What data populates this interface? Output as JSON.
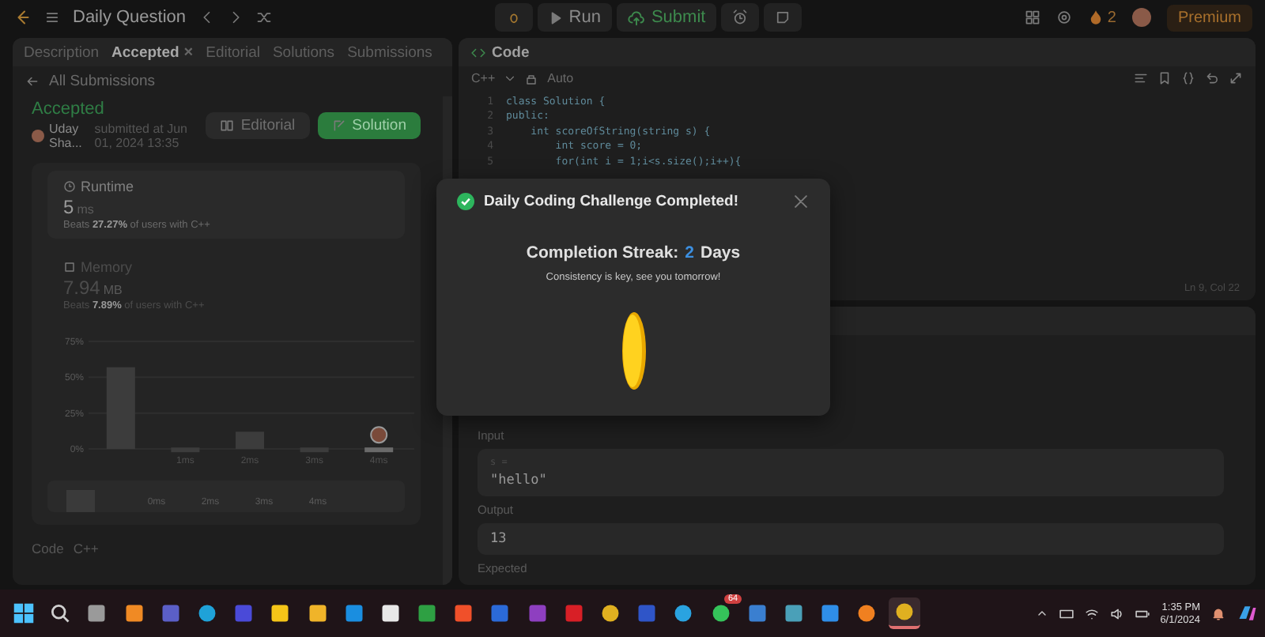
{
  "top_bar": {
    "title": "Daily Question",
    "run": "Run",
    "submit": "Submit",
    "streak": "2",
    "premium": "Premium"
  },
  "left_panel": {
    "tabs": [
      {
        "label": "Description",
        "selected": false
      },
      {
        "label": "Accepted",
        "selected": true,
        "close": "×"
      },
      {
        "label": "Editorial",
        "selected": false
      },
      {
        "label": "Solutions",
        "selected": false
      },
      {
        "label": "Submissions",
        "selected": false
      }
    ],
    "back_link": "All Submissions",
    "status": "Accepted",
    "author": "Uday Sha...",
    "submitted": "submitted at Jun 01, 2024 13:35",
    "buttons": [
      {
        "label": "Editorial",
        "kind": "secondary"
      },
      {
        "label": "Solution",
        "kind": "primary"
      }
    ],
    "stats": [
      {
        "title": "Runtime",
        "value": "5",
        "unit": "ms",
        "beats": "Beats **27.27%** of users with C++",
        "selected": true
      },
      {
        "title": "Memory",
        "value": "7.94",
        "unit": "MB",
        "beats": "Beats **7.89%** of users with C++",
        "selected": false
      }
    ],
    "runtime_chart": {
      "chart_data": {
        "type": "bar",
        "x": [
          0,
          1,
          2,
          3,
          4
        ],
        "values": [
          57,
          1,
          12,
          1,
          1
        ],
        "xlim": [
          -0.5,
          4.5
        ],
        "ylim": [
          0,
          75
        ],
        "yticks": [
          {
            "value": 0,
            "label": "0%"
          },
          {
            "value": 25,
            "label": "25%"
          },
          {
            "value": 50,
            "label": "50%"
          },
          {
            "value": 75,
            "label": "75%"
          }
        ],
        "xticks": [
          {
            "value": 1,
            "label": "1ms"
          },
          {
            "value": 2,
            "label": "2ms"
          },
          {
            "value": 3,
            "label": "3ms"
          },
          {
            "value": 4,
            "label": "4ms"
          }
        ]
      }
    },
    "range_labels": [
      "0ms",
      "2ms",
      "3ms",
      "4ms"
    ],
    "footer": {
      "label": "Code",
      "language": "C++"
    }
  },
  "code_panel": {
    "title": "Code",
    "language": "C++",
    "mode": "Auto",
    "lines": [
      {
        "number": "1",
        "text": "class Solution {"
      },
      {
        "number": "2",
        "text": "public:"
      },
      {
        "number": "3",
        "text": "    int scoreOfString(string s) {"
      },
      {
        "number": "4",
        "text": "        int score = 0;"
      },
      {
        "number": "5",
        "text": "        for(int i = 1;i<s.size();i++){"
      }
    ],
    "position": "Ln 9, Col 22"
  },
  "test_panel": {
    "sections": [
      {
        "label": "Input",
        "variable": "s =",
        "value": "\"hello\""
      },
      {
        "label": "Output",
        "value": "13"
      },
      {
        "label": "Expected"
      }
    ]
  },
  "dialog": {
    "title": "Daily Coding Challenge Completed!",
    "streak_label": "Completion Streak:",
    "streak_value": "2",
    "streak_unit": "Days",
    "message": "Consistency is key, see you tomorrow!"
  },
  "taskbar": {
    "apps": [
      {
        "kind": "start",
        "color": "#4cc2ff",
        "selected": false
      },
      {
        "kind": "search",
        "color": "#d0d0d0",
        "selected": false
      },
      {
        "kind": "tile",
        "color": "#9a9a9a",
        "selected": false
      },
      {
        "kind": "tile",
        "color": "#f08a24",
        "selected": false
      },
      {
        "kind": "tile",
        "color": "#5b5fc7",
        "selected": false
      },
      {
        "kind": "circle",
        "color": "#1fa2d8",
        "selected": false
      },
      {
        "kind": "tile",
        "color": "#4a4ad8",
        "selected": false
      },
      {
        "kind": "tile",
        "color": "#f5c518",
        "selected": false
      },
      {
        "kind": "tile",
        "color": "#f0b429",
        "selected": false
      },
      {
        "kind": "tile",
        "color": "#1a8ee0",
        "selected": false
      },
      {
        "kind": "tile",
        "color": "#e8e8e8",
        "selected": false
      },
      {
        "kind": "tile",
        "color": "#2ea043",
        "selected": false
      },
      {
        "kind": "tile",
        "color": "#f0502a",
        "selected": false
      },
      {
        "kind": "tile",
        "color": "#2b6ad8",
        "selected": false
      },
      {
        "kind": "tile",
        "color": "#8e3fc0",
        "selected": false
      },
      {
        "kind": "tile",
        "color": "#d81f26",
        "selected": false
      },
      {
        "kind": "circle",
        "color": "#e0b020",
        "selected": false
      },
      {
        "kind": "tile",
        "color": "#2f55c8",
        "selected": false
      },
      {
        "kind": "circle",
        "color": "#2aa3e0",
        "selected": false
      },
      {
        "kind": "circle",
        "color": "#35c35a",
        "selected": false,
        "badge": "64"
      },
      {
        "kind": "tile",
        "color": "#3a7fd0",
        "selected": false
      },
      {
        "kind": "tile",
        "color": "#4aa0b8",
        "selected": false
      },
      {
        "kind": "tile",
        "color": "#2f8ee8",
        "selected": false
      },
      {
        "kind": "circle",
        "color": "#f08020",
        "selected": false
      },
      {
        "kind": "circle",
        "color": "#e0b020",
        "selected": true
      }
    ],
    "time": "1:35 PM",
    "date": "6/1/2024"
  }
}
